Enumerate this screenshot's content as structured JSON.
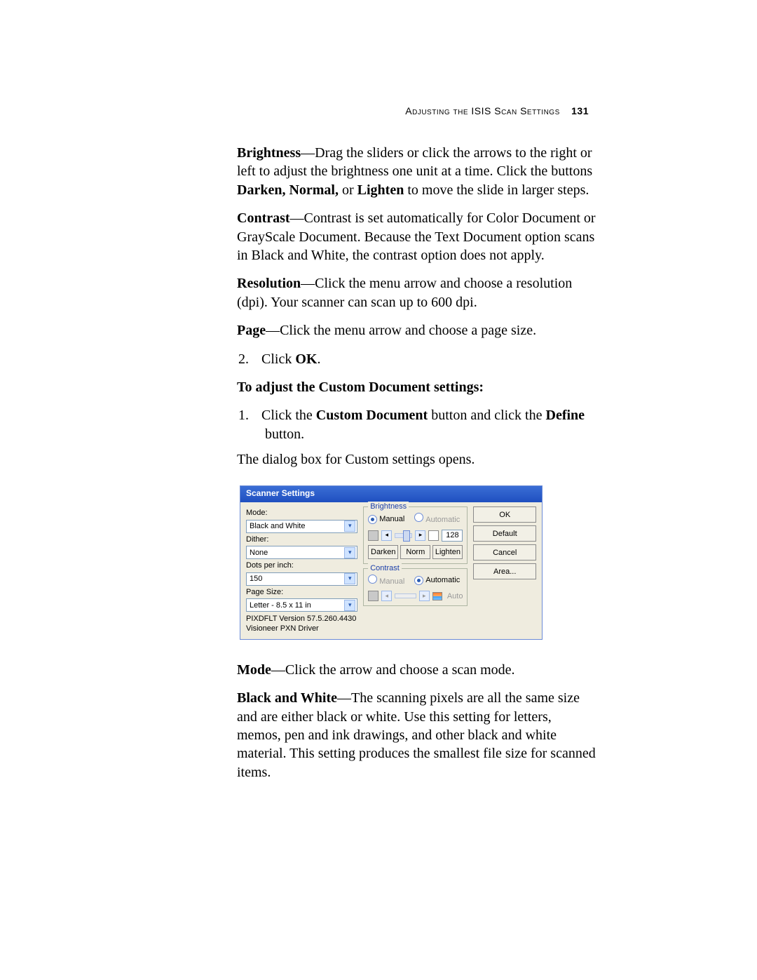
{
  "header": {
    "section_title": "Adjusting the ISIS Scan Settings",
    "page_number": "131"
  },
  "body": {
    "p1a_b": "Brightness",
    "p1a_t": "—Drag the sliders or click the arrows to the right or left to adjust the brightness one unit at a time. Click the buttons ",
    "p1b_b": "Darken, Normal,",
    "p1b_mid": " or ",
    "p1b_b2": "Lighten",
    "p1b_t": " to move the slide in larger steps.",
    "p2_b": "Contrast",
    "p2_t": "—Contrast is set automatically for Color Document or GrayScale Document. Because the Text Document option scans in Black and White, the contrast option does not apply.",
    "p3_b": "Resolution",
    "p3_t": "—Click the menu arrow and choose a resolution (dpi). Your scanner can scan up to 600 dpi.",
    "p4_b": "Page",
    "p4_t": "—Click the menu arrow and choose a page size.",
    "step2_num": "2.",
    "step2_a": "Click ",
    "step2_b": "OK",
    "step2_c": ".",
    "subhead": "To adjust the Custom Document settings:",
    "step1_num": "1.",
    "step1_a": "Click the ",
    "step1_b1": "Custom Document",
    "step1_mid": " button and click the ",
    "step1_b2": "Define",
    "step1_c": " button.",
    "step1_p2": "The dialog box for Custom settings opens.",
    "p5_b": "Mode",
    "p5_t": "—Click the arrow and choose a scan mode.",
    "p6_b": "Black and White",
    "p6_t": "—The scanning pixels are all the same size and are either black or white. Use this setting for letters, memos, pen and ink drawings, and other black and white material. This setting produces the smallest file size for scanned items."
  },
  "dialog": {
    "title": "Scanner Settings",
    "left": {
      "mode_label": "Mode:",
      "mode_value": "Black and White",
      "dither_label": "Dither:",
      "dither_value": "None",
      "dpi_label": "Dots per inch:",
      "dpi_value": "150",
      "pagesize_label": "Page Size:",
      "pagesize_value": "Letter - 8.5 x 11 in",
      "version_line1": "PIXDFLT Version 57.5.260.4430",
      "version_line2": "Visioneer PXN Driver"
    },
    "brightness": {
      "legend": "Brightness",
      "manual": "Manual",
      "automatic": "Automatic",
      "value": "128",
      "darken": "Darken",
      "norm": "Norm",
      "lighten": "Lighten"
    },
    "contrast": {
      "legend": "Contrast",
      "manual": "Manual",
      "automatic": "Automatic",
      "auto_label": "Auto"
    },
    "buttons": {
      "ok": "OK",
      "default": "Default",
      "cancel": "Cancel",
      "area": "Area..."
    }
  }
}
